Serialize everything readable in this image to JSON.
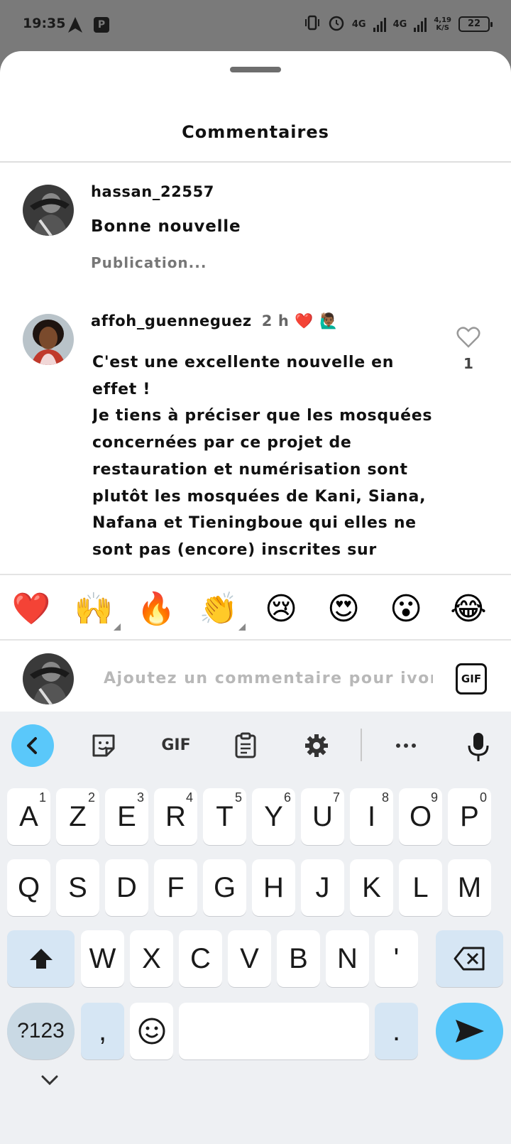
{
  "status_bar": {
    "time": "19:35",
    "app_badge": "P",
    "net1": "4G",
    "net2": "4G",
    "speed_value": "4,19",
    "speed_unit": "K/S",
    "battery": "22"
  },
  "sheet": {
    "title": "Commentaires"
  },
  "comments": [
    {
      "username": "hassan_22557",
      "text": "Bonne nouvelle",
      "subtext": "Publication..."
    },
    {
      "username": "affoh_guenneguez",
      "time": "2 h",
      "reaction_emojis": "❤️ 🙋🏾‍♂️",
      "text": "C'est une excellente nouvelle en effet !\nJe tiens à préciser que les mosquées concernées par ce projet de restauration et numérisation sont plutôt les mosquées de Kani, Siana, Nafana et Tieningboue qui elles ne sont pas (encore) inscrites sur",
      "like_count": "1"
    }
  ],
  "emoji_bar": [
    "❤️",
    "🙌",
    "🔥",
    "👏",
    "😢",
    "😍",
    "😮",
    "😂"
  ],
  "input": {
    "placeholder": "Ajoutez un commentaire pour ivoris",
    "gif_label": "GIF"
  },
  "keyboard": {
    "toolbar_gif": "GIF",
    "row1": [
      {
        "letter": "A",
        "hint": "1"
      },
      {
        "letter": "Z",
        "hint": "2"
      },
      {
        "letter": "E",
        "hint": "3"
      },
      {
        "letter": "R",
        "hint": "4"
      },
      {
        "letter": "T",
        "hint": "5"
      },
      {
        "letter": "Y",
        "hint": "6"
      },
      {
        "letter": "U",
        "hint": "7"
      },
      {
        "letter": "I",
        "hint": "8"
      },
      {
        "letter": "O",
        "hint": "9"
      },
      {
        "letter": "P",
        "hint": "0"
      }
    ],
    "row2": [
      "Q",
      "S",
      "D",
      "F",
      "G",
      "H",
      "J",
      "K",
      "L",
      "M"
    ],
    "row3": [
      "W",
      "X",
      "C",
      "V",
      "B",
      "N",
      "'"
    ],
    "sym_label": "?123",
    "comma": ",",
    "period": "."
  }
}
